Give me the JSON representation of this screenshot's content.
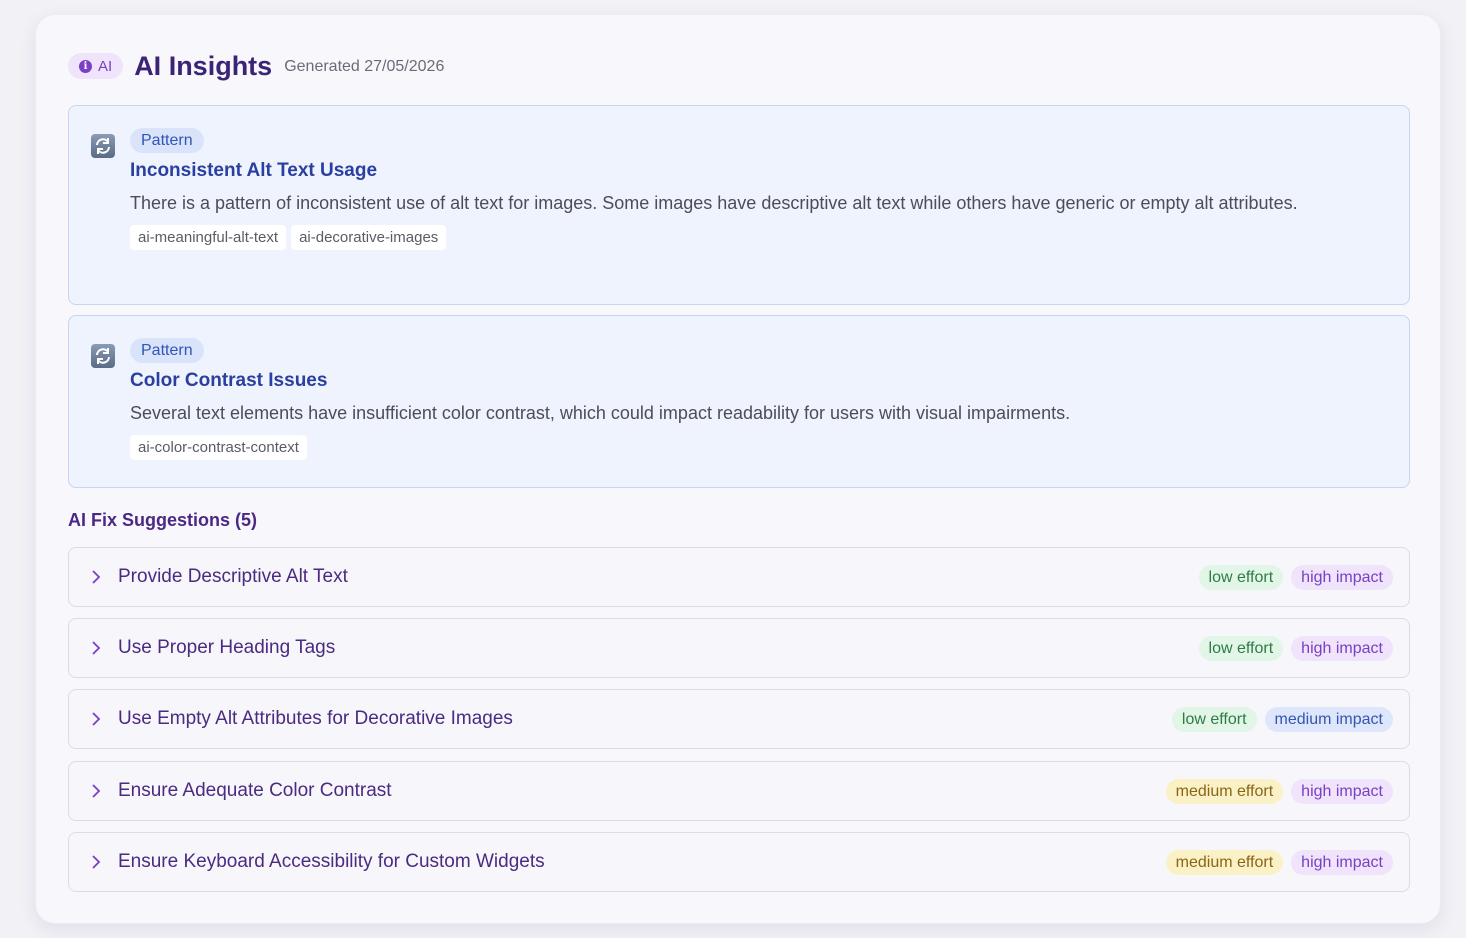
{
  "header": {
    "ai_badge": "AI",
    "title": "AI Insights",
    "generated": "Generated 27/05/2026"
  },
  "insights": [
    {
      "type": "Pattern",
      "icon": "refresh-icon",
      "title": "Inconsistent Alt Text Usage",
      "description": "There is a pattern of inconsistent use of alt text for images. Some images have descriptive alt text while others have generic or empty alt attributes.",
      "tags": [
        "ai-meaningful-alt-text",
        "ai-decorative-images"
      ]
    },
    {
      "type": "Pattern",
      "icon": "refresh-icon",
      "title": "Color Contrast Issues",
      "description": "Several text elements have insufficient color contrast, which could impact readability for users with visual impairments.",
      "tags": [
        "ai-color-contrast-context"
      ]
    }
  ],
  "fix_suggestions": {
    "heading": "AI Fix Suggestions (5)",
    "items": [
      {
        "title": "Provide Descriptive Alt Text",
        "effort": "low effort",
        "impact": "high impact"
      },
      {
        "title": "Use Proper Heading Tags",
        "effort": "low effort",
        "impact": "high impact"
      },
      {
        "title": "Use Empty Alt Attributes for Decorative Images",
        "effort": "low effort",
        "impact": "medium impact"
      },
      {
        "title": "Ensure Adequate Color Contrast",
        "effort": "medium effort",
        "impact": "high impact"
      },
      {
        "title": "Ensure Keyboard Accessibility for Custom Widgets",
        "effort": "medium effort",
        "impact": "high impact"
      }
    ]
  },
  "colors": {
    "accent_purple": "#7a3fc4",
    "title_purple": "#3b2476",
    "insight_blue": "#2a3fa0",
    "effort_low": "#2f7a46",
    "effort_medium": "#8a6514"
  }
}
